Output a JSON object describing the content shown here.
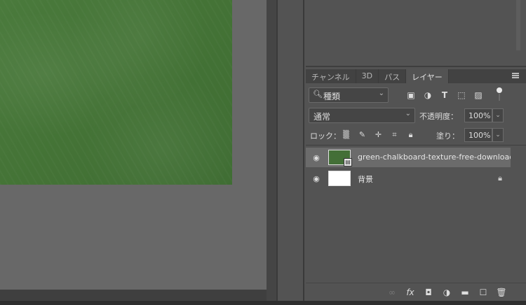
{
  "colors": {
    "canvas_bg": "#686868",
    "chalkboard": "#456f3a",
    "panel_bg": "#535353",
    "selected_layer": "#6b6b6b"
  },
  "tabs": [
    {
      "label": "チャンネル",
      "active": false
    },
    {
      "label": "3D",
      "active": false
    },
    {
      "label": "パス",
      "active": false
    },
    {
      "label": "レイヤー",
      "active": true
    }
  ],
  "filter": {
    "kind_label": "種類",
    "icons": [
      "image-filter-icon",
      "adjustment-filter-icon",
      "type-filter-icon",
      "shape-filter-icon",
      "smart-object-filter-icon"
    ]
  },
  "blend": {
    "mode": "通常",
    "opacity_label": "不透明度：",
    "opacity_value": "100%"
  },
  "lock": {
    "label": "ロック：",
    "fill_label": "塗り：",
    "fill_value": "100%"
  },
  "layers": [
    {
      "name": "green-chalkboard-texture-free-download",
      "selected": true,
      "visible": true
    },
    {
      "name": "背景",
      "selected": false,
      "visible": true,
      "locked": true
    }
  ]
}
